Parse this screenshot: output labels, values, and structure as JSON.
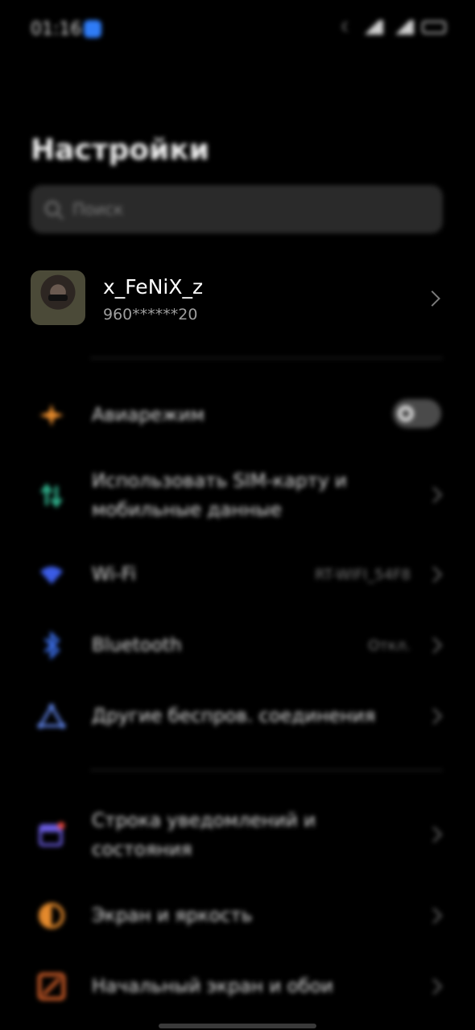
{
  "status_bar": {
    "time": "01:16"
  },
  "header": {
    "title": "Настройки"
  },
  "search": {
    "placeholder": "Поиск"
  },
  "profile": {
    "name": "x_FeNiX_z",
    "phone": "960******20"
  },
  "settings": [
    {
      "label": "Авиарежим",
      "icon": "airplane-icon",
      "color": "#e58a2c",
      "toggle": false
    },
    {
      "label": "Использовать SIM-карту и мобильные данные",
      "icon": "mobile-data-icon",
      "color": "#2fae8a"
    },
    {
      "label": "Wi-Fi",
      "value": "RT-WIFI_54F8",
      "icon": "wifi-icon",
      "color": "#3b5ce6"
    },
    {
      "label": "Bluetooth",
      "value": "Откл.",
      "icon": "bluetooth-icon",
      "color": "#3b6ee8"
    },
    {
      "label": "Другие беспров. соединения",
      "icon": "connections-icon",
      "color": "#5c7fe0"
    },
    {
      "label": "Строка уведомлений и состояния",
      "icon": "notification-bar-icon",
      "color": "#6a5ce0"
    },
    {
      "label": "Экран и яркость",
      "icon": "brightness-icon",
      "color": "#e58a2c"
    },
    {
      "label": "Начальный экран и обои",
      "icon": "wallpaper-icon",
      "color": "#e0652c"
    }
  ]
}
